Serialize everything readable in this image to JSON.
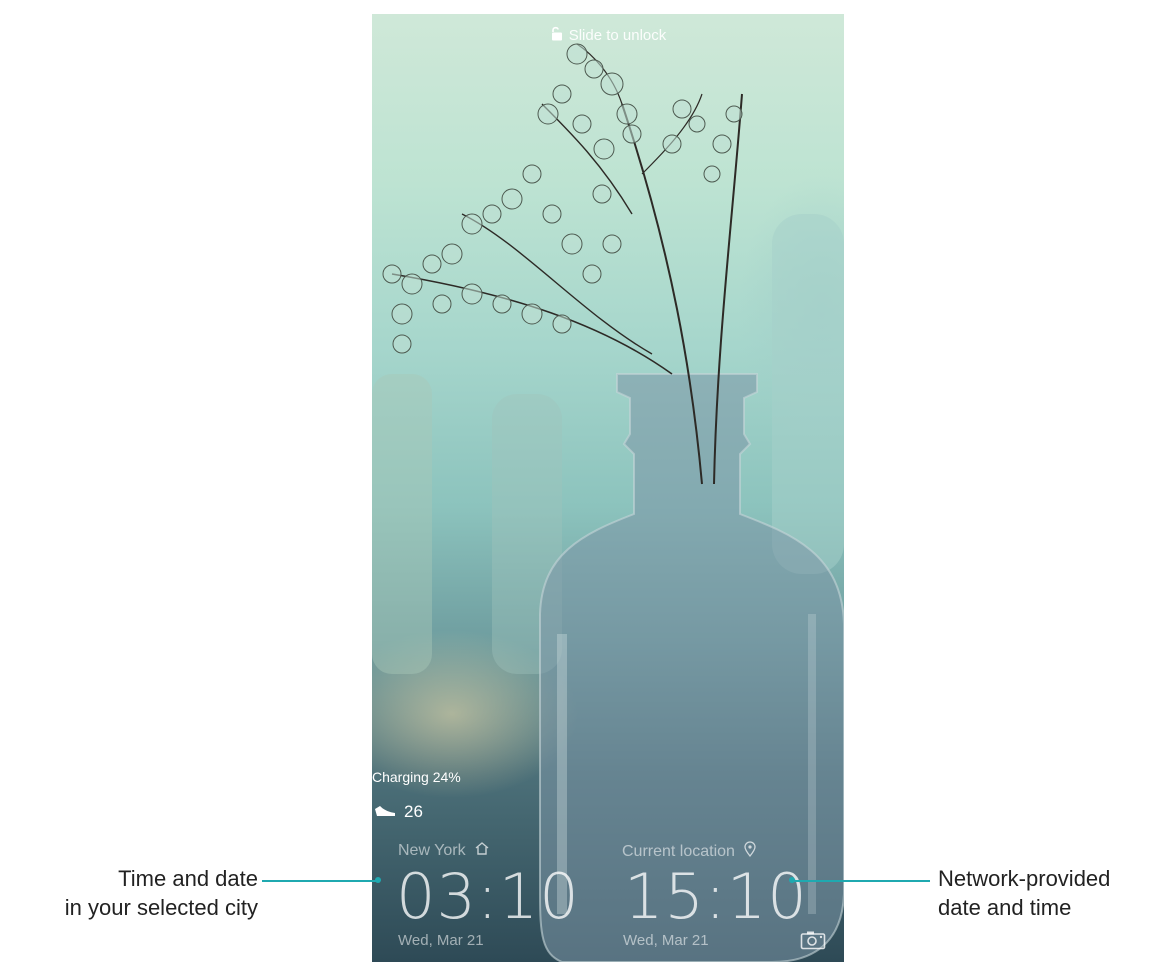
{
  "lockscreen": {
    "unlock_hint": "Slide to unlock",
    "charging_status": "Charging 24%",
    "step_count": "26",
    "home_clock": {
      "city": "New York",
      "time": "03:10",
      "date": "Wed, Mar 21"
    },
    "local_clock": {
      "city": "Current location",
      "time": "15:10",
      "date": "Wed, Mar 21"
    }
  },
  "annotations": {
    "left_line1": "Time and date",
    "left_line2": "in your selected city",
    "right_line1": "Network-provided",
    "right_line2": "date and time"
  },
  "colors": {
    "callout_line": "#1fa9b0"
  },
  "icons": {
    "unlock": "lock-open-icon",
    "steps": "shoe-icon",
    "home": "home-icon",
    "location": "location-pin-icon",
    "camera": "camera-icon"
  }
}
